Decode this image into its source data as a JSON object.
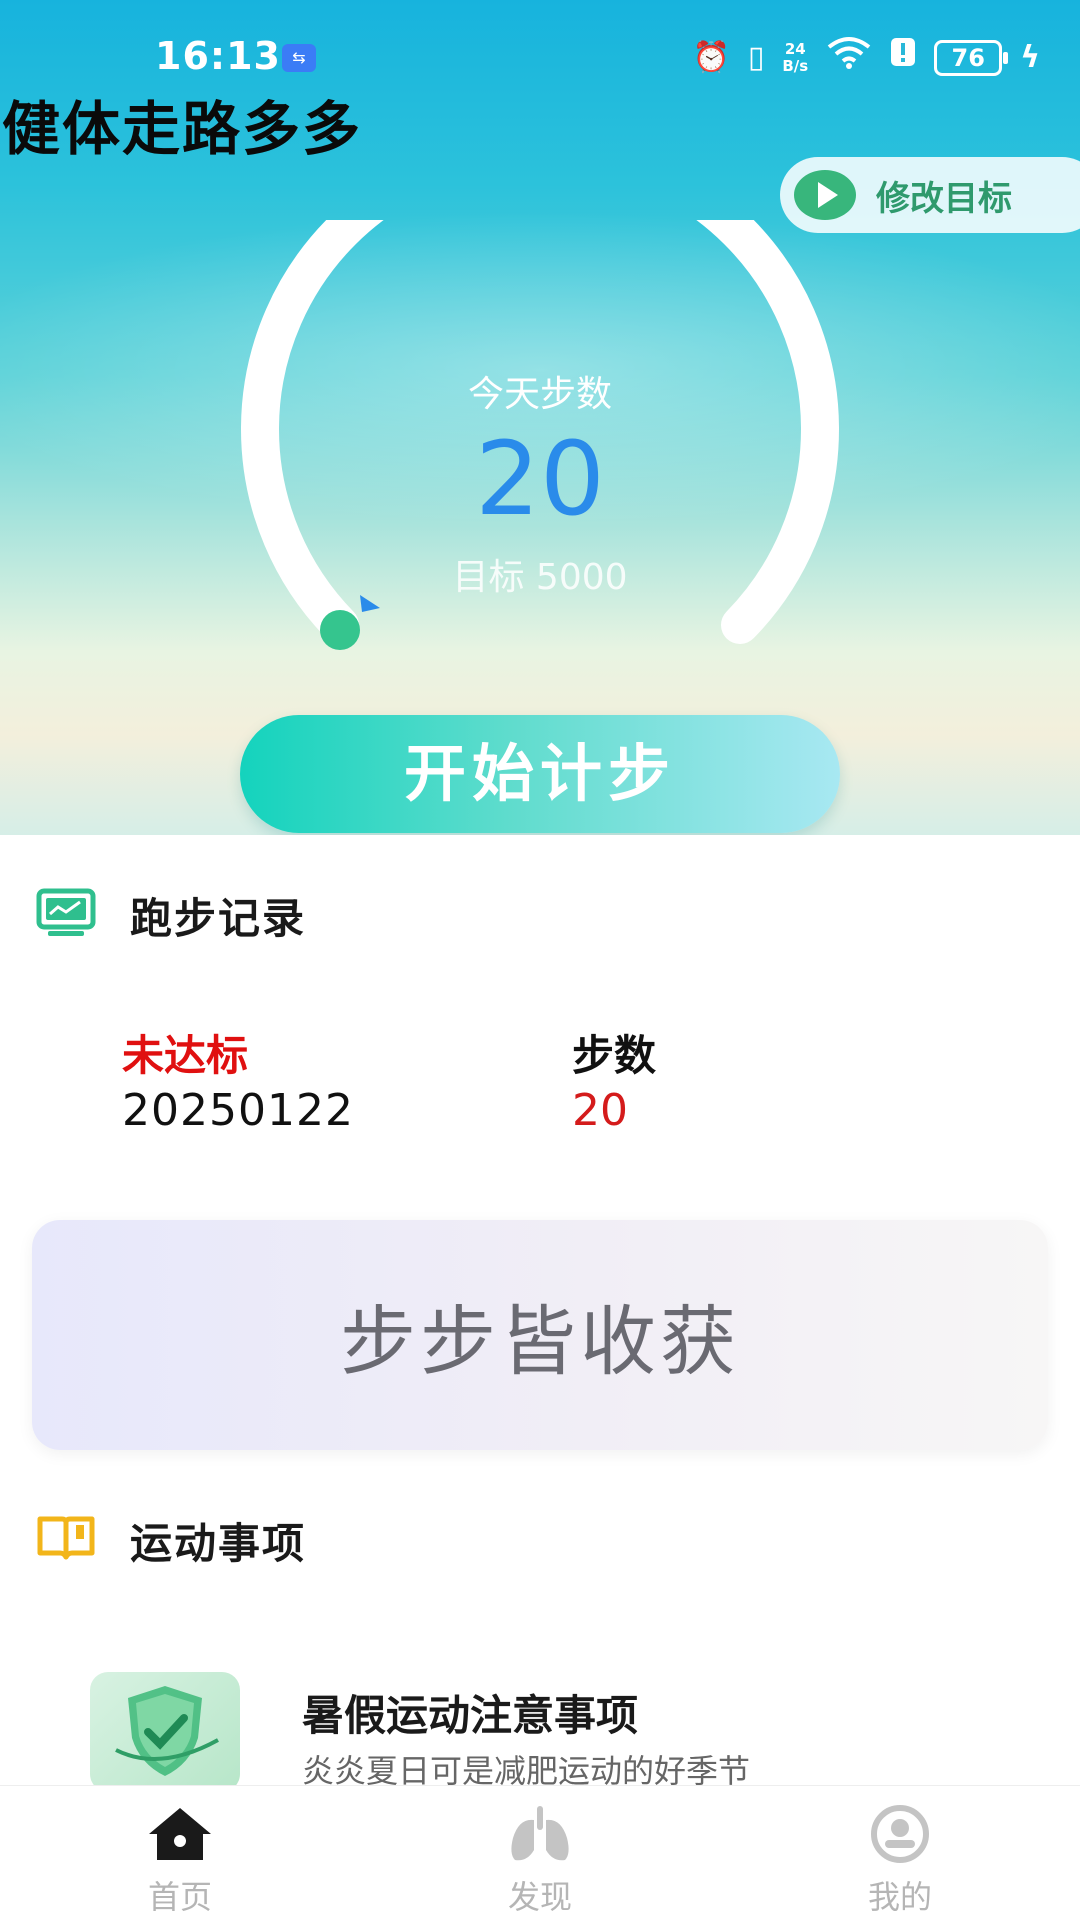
{
  "status_bar": {
    "time": "16:13",
    "net_speed_value": "24",
    "net_speed_unit": "B/s",
    "battery": "76"
  },
  "app": {
    "title": "健体走路多多"
  },
  "goal_button": {
    "label": "修改目标"
  },
  "ring": {
    "label": "今天步数",
    "value": "20",
    "goal_text": "目标 5000",
    "progress": 0.004
  },
  "start_button": {
    "label": "开始计步"
  },
  "records": {
    "title": "跑步记录",
    "status": "未达标",
    "date": "20250122",
    "steps_header": "步数",
    "steps_value": "20"
  },
  "banner": {
    "text": "步步皆收获"
  },
  "tips": {
    "title": "运动事项",
    "article": {
      "title": "暑假运动注意事项",
      "desc": "炎炎夏日可是减肥运动的好季节"
    }
  },
  "nav": [
    {
      "label": "首页",
      "icon": "home-icon",
      "active": true
    },
    {
      "label": "发现",
      "icon": "lungs-icon",
      "active": false
    },
    {
      "label": "我的",
      "icon": "profile-icon",
      "active": false
    }
  ],
  "colors": {
    "accent_green": "#38b67c",
    "step_blue": "#2a8bea",
    "warn_red": "#e01010",
    "nav_active": "#1a1a1a",
    "nav_inactive": "#b5b5b5"
  }
}
